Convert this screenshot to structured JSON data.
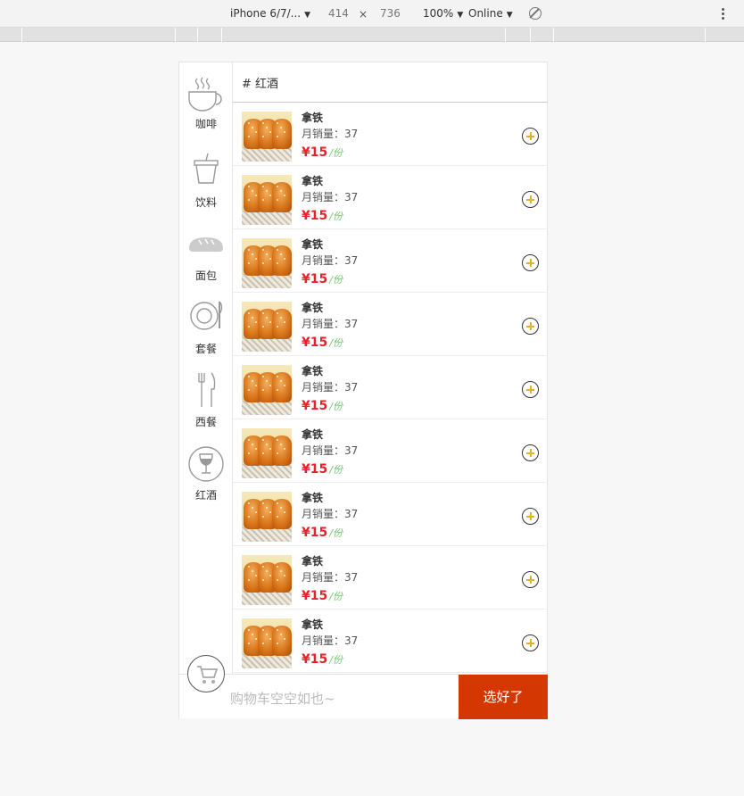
{
  "devtools": {
    "device": "iPhone 6/7/...",
    "width": "414",
    "times": "×",
    "height": "736",
    "zoom": "100%",
    "network": "Online"
  },
  "sidebar": {
    "items": [
      {
        "label": "咖啡",
        "icon": "coffee-cup-icon"
      },
      {
        "label": "饮料",
        "icon": "drink-cup-icon"
      },
      {
        "label": "面包",
        "icon": "bread-icon"
      },
      {
        "label": "套餐",
        "icon": "plate-icon"
      },
      {
        "label": "西餐",
        "icon": "fork-knife-icon"
      },
      {
        "label": "红酒",
        "icon": "wine-glass-icon"
      }
    ]
  },
  "section": {
    "title": "# 红酒"
  },
  "products": [
    {
      "name": "拿铁",
      "sales": "月销量：37",
      "price": "¥15",
      "unit": "/份"
    },
    {
      "name": "拿铁",
      "sales": "月销量：37",
      "price": "¥15",
      "unit": "/份"
    },
    {
      "name": "拿铁",
      "sales": "月销量：37",
      "price": "¥15",
      "unit": "/份"
    },
    {
      "name": "拿铁",
      "sales": "月销量：37",
      "price": "¥15",
      "unit": "/份"
    },
    {
      "name": "拿铁",
      "sales": "月销量：37",
      "price": "¥15",
      "unit": "/份"
    },
    {
      "name": "拿铁",
      "sales": "月销量：37",
      "price": "¥15",
      "unit": "/份"
    },
    {
      "name": "拿铁",
      "sales": "月销量：37",
      "price": "¥15",
      "unit": "/份"
    },
    {
      "name": "拿铁",
      "sales": "月销量：37",
      "price": "¥15",
      "unit": "/份"
    },
    {
      "name": "拿铁",
      "sales": "月销量：37",
      "price": "¥15",
      "unit": "/份"
    }
  ],
  "cart": {
    "empty_text": "购物车空空如也~",
    "confirm_label": "选好了"
  },
  "colors": {
    "price": "#e8212a",
    "unit": "#6fc76b",
    "confirm_button": "#d43702",
    "add_plus": "#e4b22a"
  }
}
